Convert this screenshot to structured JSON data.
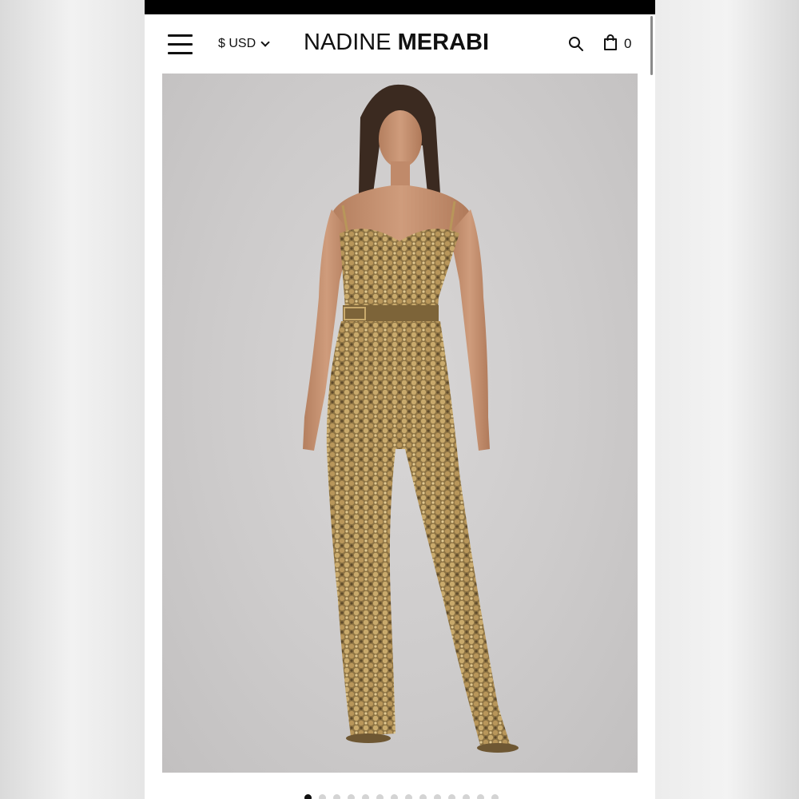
{
  "header": {
    "currency": "$ USD",
    "brand_part1": "NADINE ",
    "brand_part2": "MERABI",
    "cart_count": "0"
  },
  "gallery": {
    "slide_count": 14,
    "active_index": 0
  },
  "colors": {
    "background": "#ffffff",
    "text": "#111111",
    "image_bg": "#cdcbcb",
    "sequin_gold": "#a88a55"
  }
}
